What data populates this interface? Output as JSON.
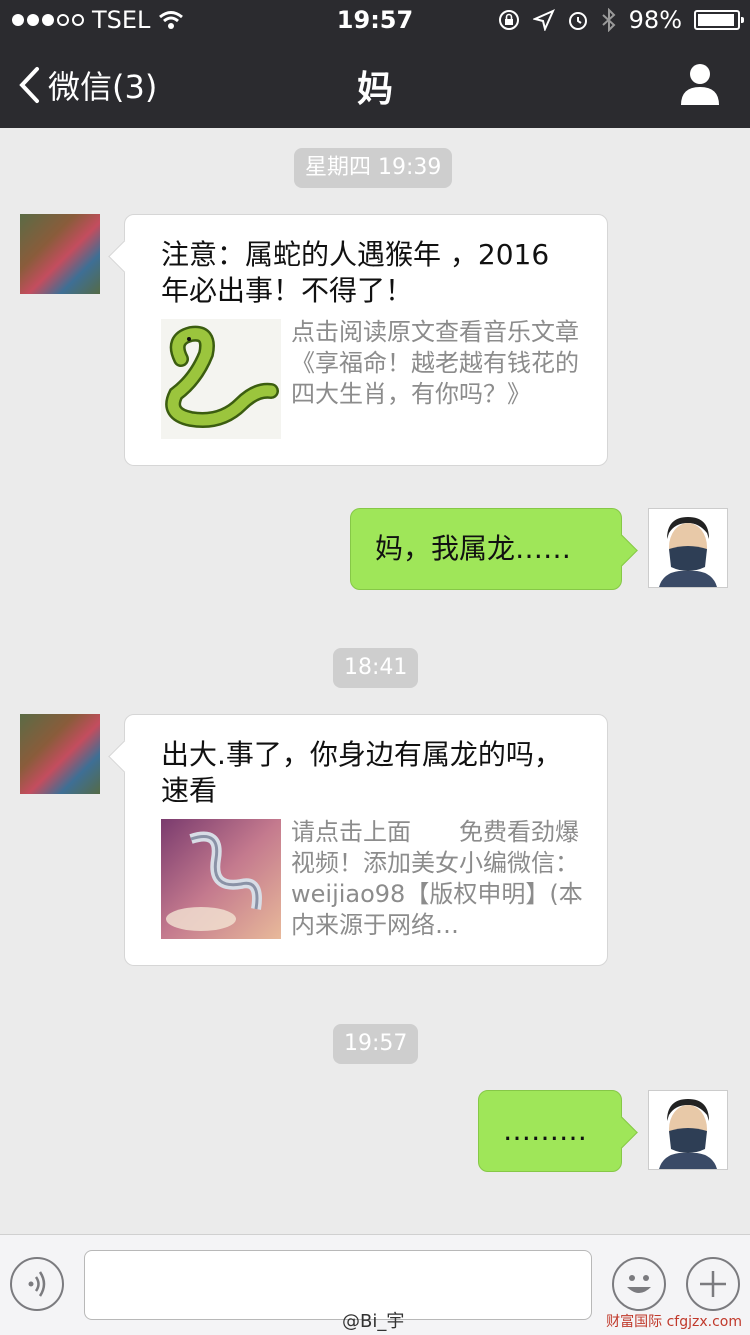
{
  "status": {
    "carrier": "TSEL",
    "time": "19:57",
    "battery": "98%",
    "battery_level": 0.98
  },
  "nav": {
    "back_label": "微信(3)",
    "title": "妈"
  },
  "messages": [
    {
      "type": "timestamp",
      "text": "星期四 19:39"
    },
    {
      "type": "card",
      "from": "mom",
      "title": "注意：属蛇的人遇猴年 ，2016年必出事！不得了！",
      "desc": "点击阅读原文查看音乐文章《享福命！越老越有钱花的四大生肖，有你吗？》"
    },
    {
      "type": "text",
      "from": "me",
      "text": "妈，我属龙……"
    },
    {
      "type": "timestamp",
      "text": "18:41"
    },
    {
      "type": "card",
      "from": "mom",
      "title": "出大.事了，你身边有属龙的吗，速看",
      "desc": "请点击上面　　免费看劲爆视频！添加美女小编微信：weijiao98【版权申明】(本内来源于网络…"
    },
    {
      "type": "timestamp",
      "text": "19:57"
    },
    {
      "type": "text",
      "from": "me",
      "text": "………"
    }
  ],
  "watermark": "@Bi_宇",
  "watermark_site": "财富国际 cfgjzx.com",
  "icons": [
    "signal-dots-icon",
    "wifi-icon",
    "rotation-lock-icon",
    "location-icon",
    "alarm-icon",
    "bluetooth-icon",
    "battery-icon",
    "back-chevron-icon",
    "user-profile-icon",
    "voice-icon",
    "emoji-icon",
    "plus-icon"
  ]
}
